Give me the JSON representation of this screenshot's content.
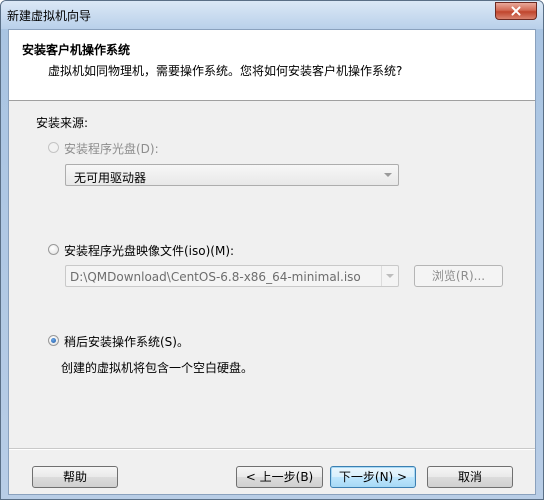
{
  "window": {
    "title": "新建虚拟机向导"
  },
  "header": {
    "title": "安装客户机操作系统",
    "subtitle": "虚拟机如同物理机，需要操作系统。您将如何安装客户机操作系统?"
  },
  "source": {
    "label": "安装来源:",
    "options": [
      {
        "label": "安装程序光盘(D):",
        "checked": false,
        "enabled": false,
        "combo_value": "无可用驱动器"
      },
      {
        "label": "安装程序光盘映像文件(iso)(M):",
        "checked": false,
        "enabled": true,
        "path_value": "D:\\QMDownload\\CentOS-6.8-x86_64-minimal.iso",
        "browse_label": "浏览(R)..."
      },
      {
        "label": "稍后安装操作系统(S)。",
        "checked": true,
        "enabled": true,
        "description": "创建的虚拟机将包含一个空白硬盘。"
      }
    ]
  },
  "buttons": {
    "help": "帮助",
    "back": "< 上一步(B)",
    "next": "下一步(N) >",
    "cancel": "取消"
  },
  "colors": {
    "title_bar": "#b9d0ea",
    "close_button": "#c0452d",
    "default_button_border": "#3c7fb1"
  }
}
